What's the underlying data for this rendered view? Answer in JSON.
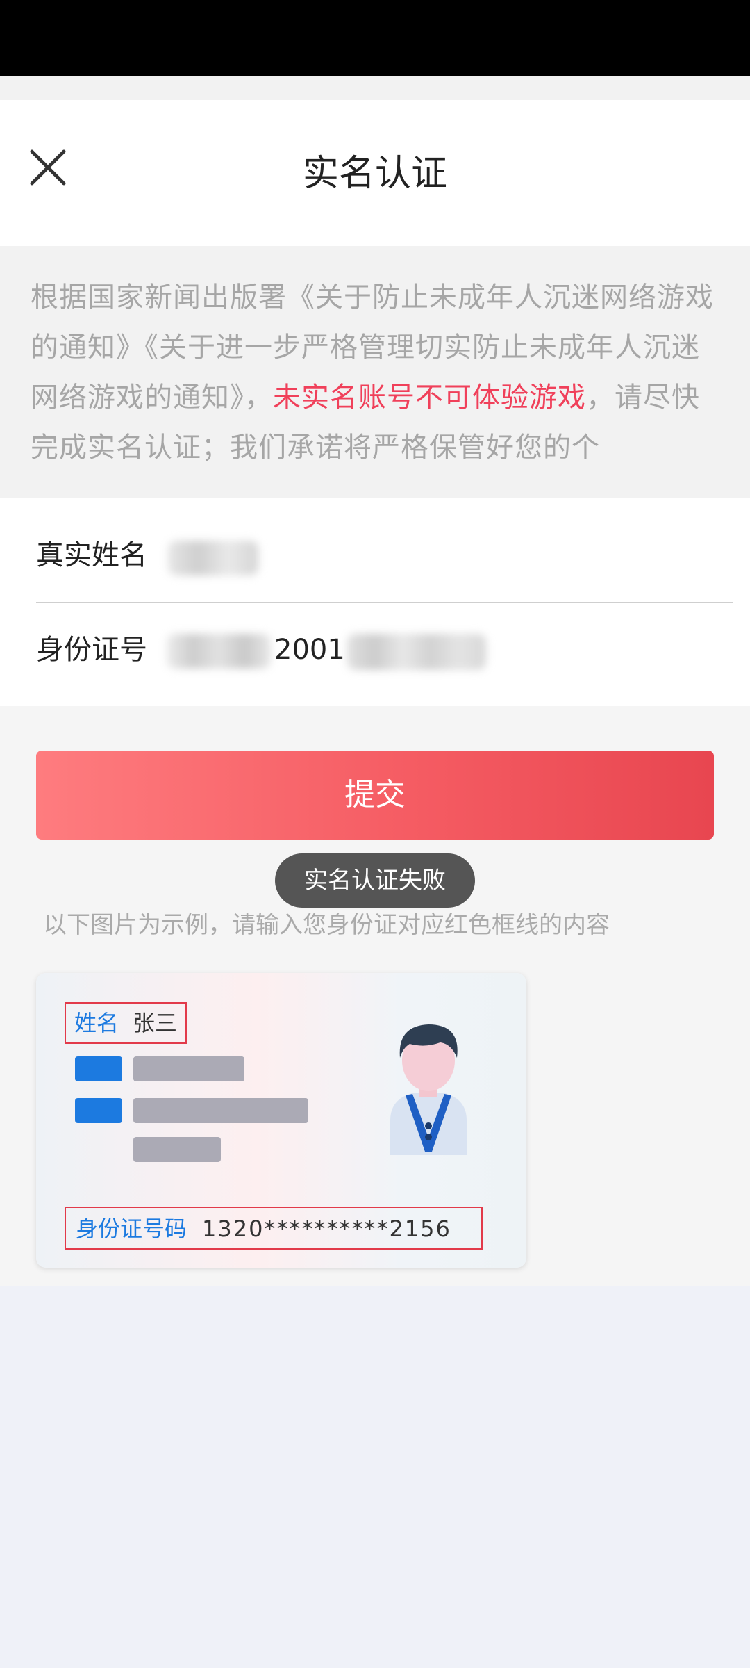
{
  "header": {
    "title": "实名认证"
  },
  "notice": {
    "text_before": "根据国家新闻出版署《关于防止未成年人沉迷网络游戏的通知》《关于进一步严格管理切实防止未成年人沉迷网络游戏的通知》，",
    "highlight": "未实名账号不可体验游戏",
    "text_after": "，请尽快完成实名认证；我们承诺将严格保管好您的个",
    "highlight_color": "#f0405a"
  },
  "form": {
    "name_label": "真实姓名",
    "id_label": "身份证号",
    "id_visible_fragment": "2001"
  },
  "submit": {
    "label": "提交"
  },
  "toast": {
    "text": "实名认证失败"
  },
  "hint": {
    "text": "以下图片为示例，请输入您身份证对应红色框线的内容"
  },
  "sample_card": {
    "name_label": "姓名",
    "name_value": "张三",
    "id_label": "身份证号码",
    "id_value": "1320**********2156"
  },
  "colors": {
    "accent_gradient_start": "#fe7c7f",
    "accent_gradient_end": "#e84650",
    "card_label_blue": "#1c7ae0",
    "frame_red": "#e23a4a"
  },
  "icons": [
    "close-icon",
    "avatar-icon"
  ]
}
